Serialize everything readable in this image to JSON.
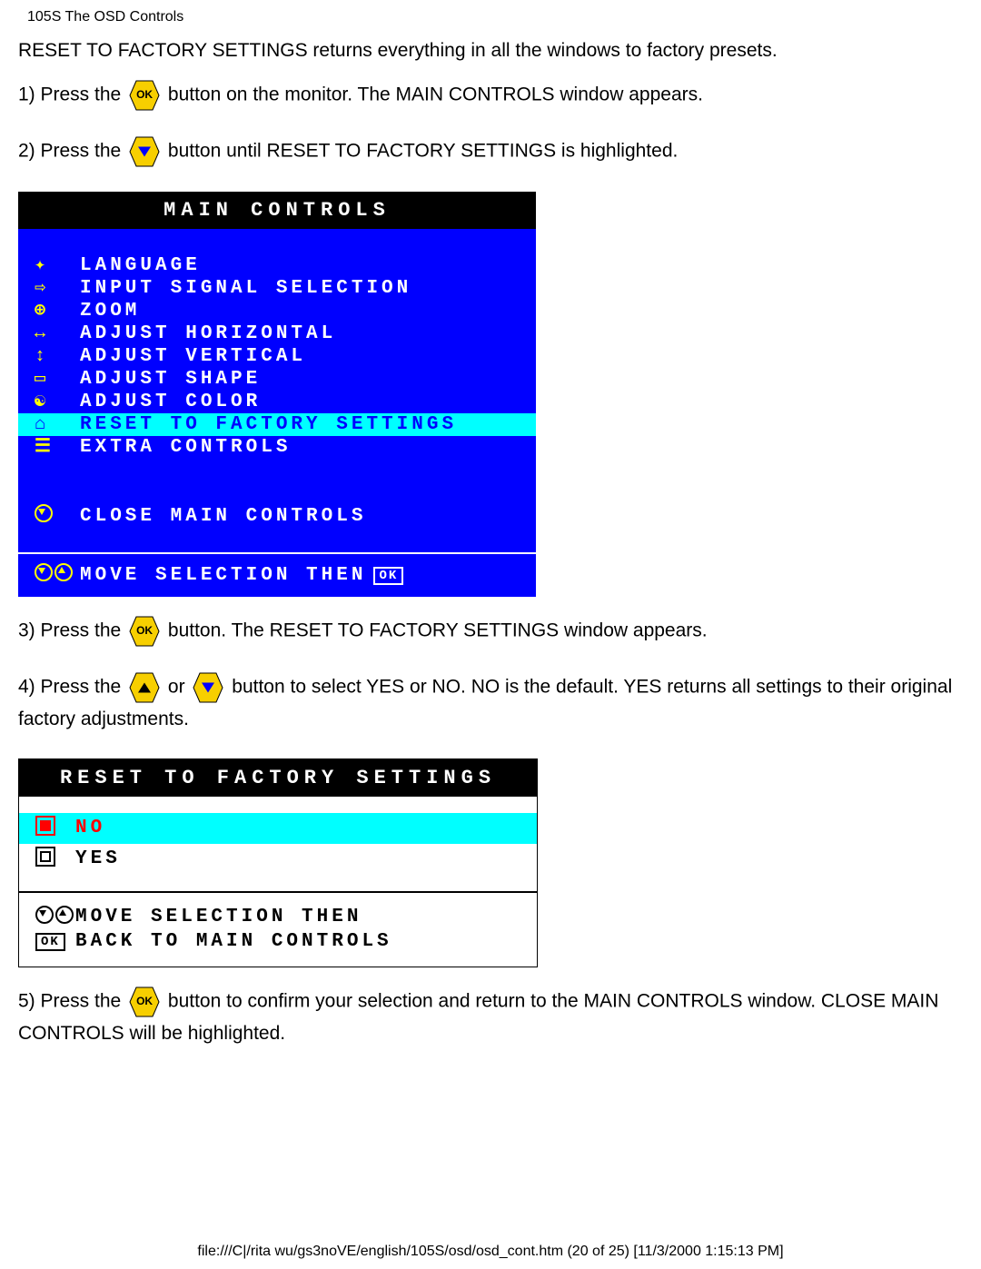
{
  "header_small": "105S The OSD Controls",
  "intro": "RESET TO FACTORY SETTINGS returns everything in all the windows to factory presets.",
  "steps": {
    "s1a": "1) Press the",
    "s1b": "button on the monitor. The MAIN CONTROLS window appears.",
    "s2a": "2) Press the",
    "s2b": "button until RESET TO FACTORY SETTINGS is highlighted.",
    "s3a": "3) Press the",
    "s3b": "button. The RESET TO FACTORY SETTINGS window appears.",
    "s4a": "4) Press the",
    "s4b": "or",
    "s4c": "button to select YES or NO. NO is the default. YES returns all settings to their original factory adjustments.",
    "s5a": "5) Press the",
    "s5b": "button to confirm your selection and return to the MAIN CONTROLS window. CLOSE MAIN CONTROLS will be highlighted."
  },
  "icons": {
    "ok_label": "OK"
  },
  "osd_main": {
    "title": "MAIN CONTROLS",
    "items": [
      {
        "icon": "✦",
        "label": "LANGUAGE",
        "hl": false
      },
      {
        "icon": "⇨",
        "label": "INPUT SIGNAL SELECTION",
        "hl": false
      },
      {
        "icon": "⊕",
        "label": "ZOOM",
        "hl": false
      },
      {
        "icon": "↔",
        "label": "ADJUST HORIZONTAL",
        "hl": false
      },
      {
        "icon": "↕",
        "label": "ADJUST VERTICAL",
        "hl": false
      },
      {
        "icon": "▭",
        "label": "ADJUST SHAPE",
        "hl": false
      },
      {
        "icon": "☯",
        "label": "ADJUST COLOR",
        "hl": false
      },
      {
        "icon": "⌂",
        "label": "RESET TO FACTORY SETTINGS",
        "hl": true
      },
      {
        "icon": "☰",
        "label": "EXTRA CONTROLS",
        "hl": false
      }
    ],
    "close": "CLOSE MAIN CONTROLS",
    "footer": "MOVE SELECTION THEN",
    "footer_ok": "OK"
  },
  "osd_reset": {
    "title": "RESET TO FACTORY SETTINGS",
    "options": [
      {
        "label": "NO",
        "hl": true
      },
      {
        "label": "YES",
        "hl": false
      }
    ],
    "footer_move": "MOVE SELECTION THEN",
    "footer_back": "BACK TO MAIN CONTROLS",
    "footer_ok": "OK"
  },
  "footer_path": "file:///C|/rita wu/gs3noVE/english/105S/osd/osd_cont.htm (20 of 25) [11/3/2000 1:15:13 PM]"
}
